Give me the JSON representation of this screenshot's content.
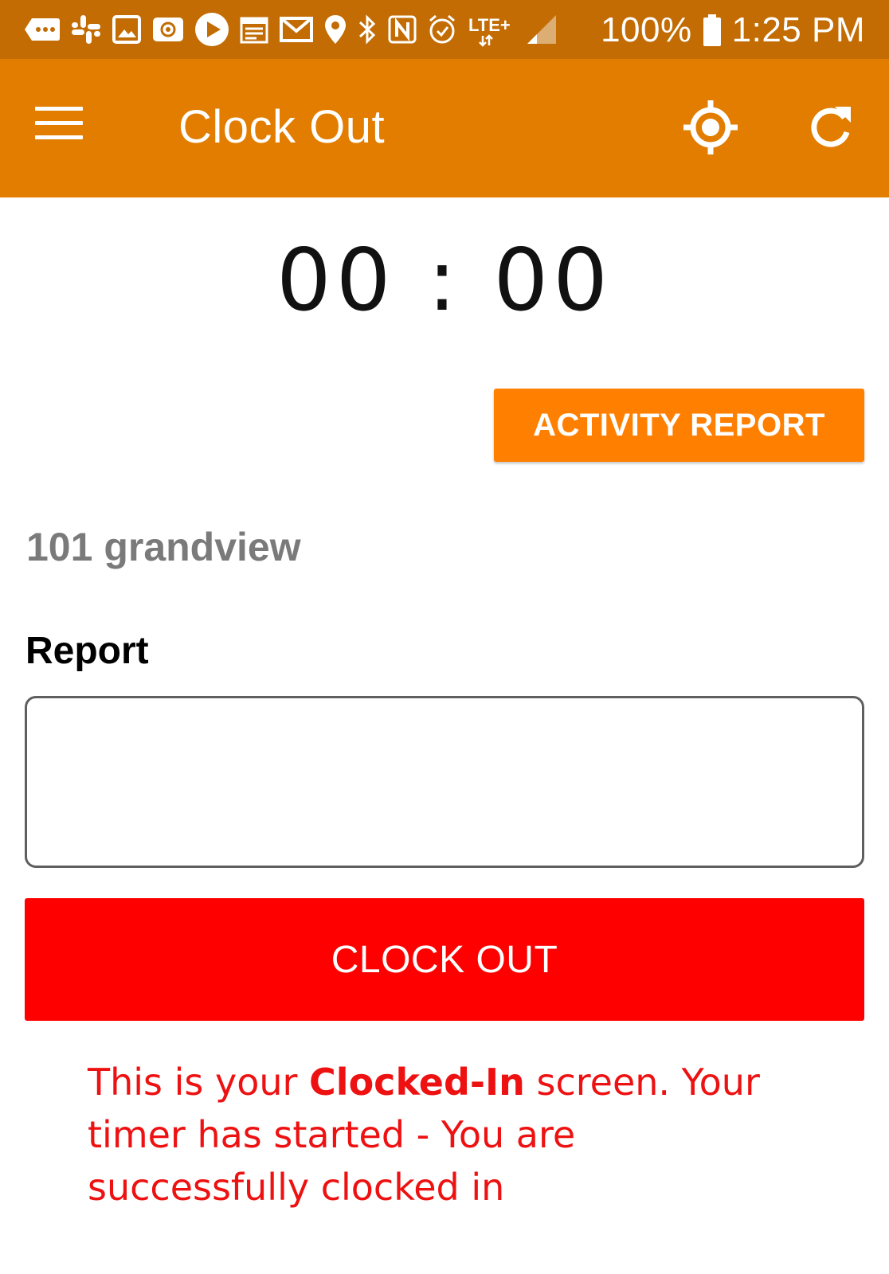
{
  "status_bar": {
    "icons": [
      "message-icon",
      "slack-icon",
      "gallery-icon",
      "email-at-icon",
      "play-icon",
      "calendar-icon",
      "gmail-icon",
      "location-pin-icon",
      "bluetooth-icon",
      "nfc-icon",
      "alarm-icon",
      "lte-icon",
      "signal-icon",
      "battery-icon"
    ],
    "network": "LTE+",
    "battery": "100%",
    "time": "1:25 PM"
  },
  "app_bar": {
    "title": "Clock Out",
    "icons": [
      "menu-icon",
      "locate-icon",
      "refresh-icon"
    ]
  },
  "main": {
    "timer": "00 : 00",
    "activity_report_label": "ACTIVITY REPORT",
    "location_name": "101 grandview",
    "report_label": "Report",
    "report_value": "",
    "clock_out_label": "CLOCK OUT",
    "note": {
      "prefix": "This is your ",
      "emphasis": "Clocked-In",
      "suffix": " screen. Your timer has started - You are successfully clocked in"
    }
  },
  "colors": {
    "status_bar": "#c26c03",
    "app_bar": "#e27d00",
    "activity_button": "#ff8000",
    "clock_out_button": "#ff0000",
    "note_text": "#ee1111"
  }
}
